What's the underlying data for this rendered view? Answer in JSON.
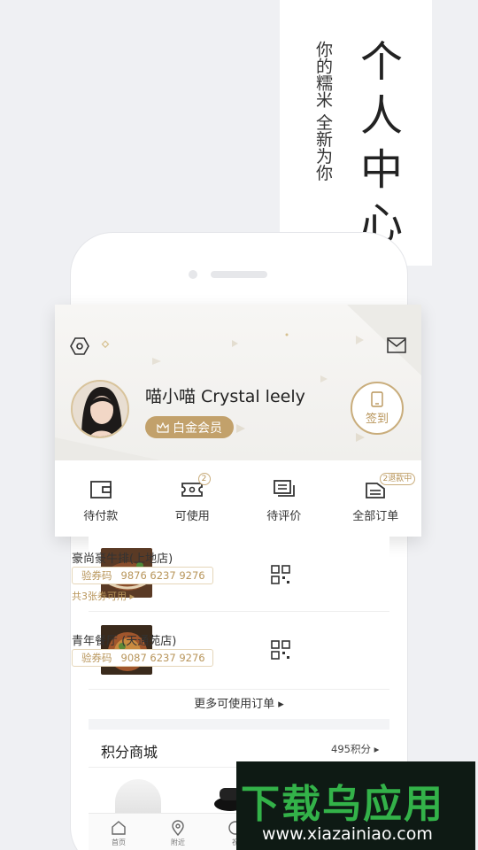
{
  "promo": {
    "title_chars": [
      "个",
      "人",
      "中",
      "心"
    ],
    "subtitle": "你的糯米 全新为你"
  },
  "profile": {
    "username": "喵小喵 Crystal leely",
    "member_level": "白金会员",
    "checkin_label": "签到",
    "icons": {
      "settings": "settings-hex-icon",
      "mail": "mail-icon",
      "crown": "crown-icon",
      "phone": "phone-icon"
    }
  },
  "orders": [
    {
      "label": "待付款",
      "icon": "wallet-icon",
      "count": ""
    },
    {
      "label": "可使用",
      "icon": "ticket-icon",
      "count": "2"
    },
    {
      "label": "待评价",
      "icon": "comment-icon",
      "count": ""
    },
    {
      "label": "全部订单",
      "icon": "order-list-icon",
      "count": "2退款中"
    }
  ],
  "vouchers": [
    {
      "name": "豪尚豪牛排(上地店)",
      "code_label": "验券码",
      "code": "9876 6237 9276",
      "count_text": "共3张券可用 ▸"
    },
    {
      "name": "青年餐厅 (天通苑店)",
      "code_label": "验券码",
      "code": "9087 6237 9276",
      "count_text": ""
    }
  ],
  "more_orders": "更多可使用订单 ▸",
  "mall": {
    "title": "积分商城",
    "points": "495积分 ▸"
  },
  "tabs": [
    {
      "label": "首页",
      "icon": "home-icon"
    },
    {
      "label": "附近",
      "icon": "location-icon"
    },
    {
      "label": "祝",
      "icon": "partial-icon"
    }
  ],
  "watermark": {
    "logo": "下载乌应用",
    "url": "www.xiazainiao.com"
  },
  "colors": {
    "gold": "#c2a16b",
    "gold_text": "#b8955a",
    "brand_green": "#33b249"
  }
}
